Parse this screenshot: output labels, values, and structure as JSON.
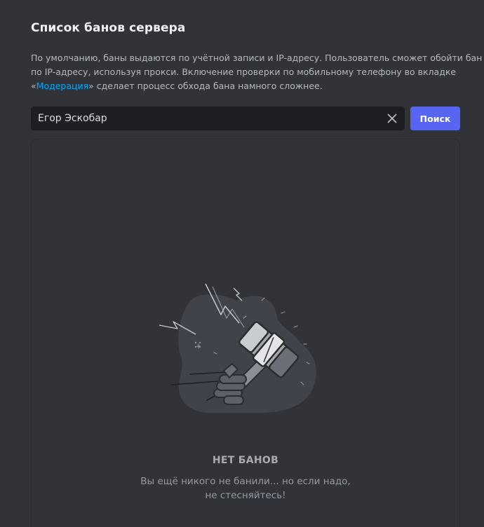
{
  "page": {
    "title": "Список банов сервера"
  },
  "description": {
    "line1": "По умолчанию, баны выдаются по учётной записи и IP-адресу. Пользователь сможет обойти бан",
    "line2": "по IP-адресу, используя прокси. Включение проверки по мобильному телефону во вкладке",
    "line3_prefix": "«",
    "link_text": "Модерация",
    "line3_suffix": "» сделает процесс обхода бана намного сложнее."
  },
  "search": {
    "value": "Егор Эскобар",
    "clear_icon": "close-icon",
    "button_label": "Поиск"
  },
  "empty_state": {
    "illustration": "ban-hammer-illustration",
    "title": "НЕТ БАНОВ",
    "subtitle_line1": "Вы ещё никого не банили... но если надо,",
    "subtitle_line2": "не стесняйтесь!"
  },
  "colors": {
    "background": "#313338",
    "input_background": "#1e1f22",
    "accent": "#5865f2",
    "link": "#00a8fc"
  }
}
